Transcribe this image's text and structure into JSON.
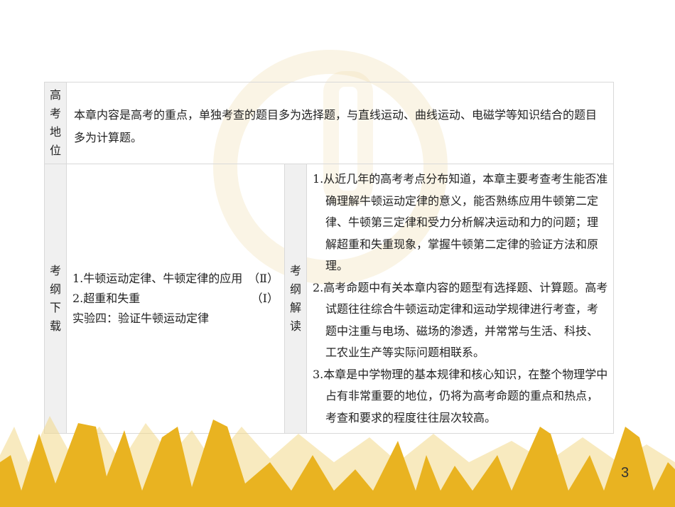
{
  "position": {
    "label": [
      "高",
      "考",
      "地",
      "位"
    ],
    "text": "本章内容是高考的重点，单独考查的题目多为选择题，与直线运动、曲线运动、电磁学等知识结合的题目多为计算题。"
  },
  "outline": {
    "label": [
      "考",
      "纲",
      "下",
      "载"
    ],
    "items": [
      {
        "text": "1.牛顿运动定律、牛顿定律的应用",
        "level": "（Ⅱ）"
      },
      {
        "text": "2.超重和失重",
        "level": "（Ⅰ）"
      },
      {
        "text": "实验四：验证牛顿运动定律",
        "level": ""
      }
    ]
  },
  "interpretation": {
    "label": [
      "考",
      "纲",
      "解",
      "读"
    ],
    "items": [
      "1.从近几年的高考考点分布知道，本章主要考查考生能否准确理解牛顿运动定律的意义，能否熟练应用牛顿第二定律、牛顿第三定律和受力分析解决运动和力的问题；理解超重和失重现象，掌握牛顿第二定律的验证方法和原理。",
      "2.高考命题中有关本章内容的题型有选择题、计算题。高考试题往往综合牛顿运动定律和运动学规律进行考查，考题中注重与电场、磁场的渗透，并常常与生活、科技、工农业生产等实际问题相联系。",
      "3.本章是中学物理的基本规律和核心知识，在整个物理学中占有非常重要的地位，仍将为高考命题的重点和热点，考查和要求的程度往往层次较高。"
    ]
  },
  "page_number": "3",
  "colors": {
    "gold": "#e9b321",
    "gold_light": "#f3d98a",
    "label_bg": "#f0f0f0"
  }
}
